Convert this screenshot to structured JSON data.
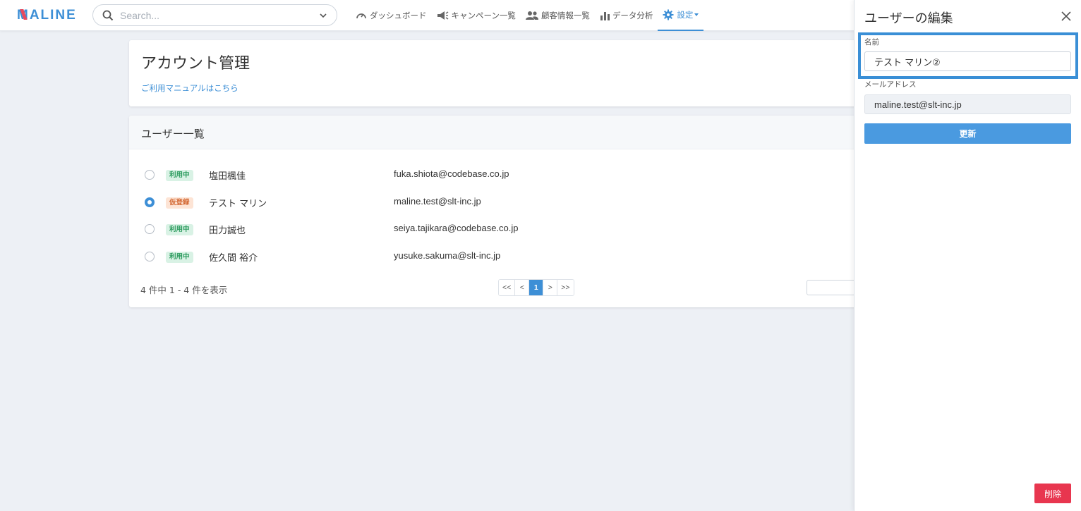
{
  "brand": {
    "logo_text": "MALINE",
    "accent": "#3d8fd6",
    "logo_accent": "#e84a5f"
  },
  "search": {
    "placeholder": "Search...",
    "value": ""
  },
  "nav": [
    {
      "label": "ダッシュボード",
      "icon": "speedometer-icon"
    },
    {
      "label": "キャンペーン一覧",
      "icon": "megaphone-icon"
    },
    {
      "label": "顧客情報一覧",
      "icon": "users-icon"
    },
    {
      "label": "データ分析",
      "icon": "bar-chart-icon"
    },
    {
      "label": "設定",
      "icon": "gear-icon",
      "active": true
    }
  ],
  "account_card": {
    "title": "アカウント管理",
    "manual_link": "ご利用マニュアルはこちら"
  },
  "user_list": {
    "title": "ユーザー一覧",
    "users": [
      {
        "status": "利用中",
        "status_type": "active",
        "name": "塩田楓佳",
        "email": "fuka.shiota@codebase.co.jp",
        "selected": false
      },
      {
        "status": "仮登録",
        "status_type": "temp",
        "name": "テスト マリン",
        "email": "maline.test@slt-inc.jp",
        "selected": true
      },
      {
        "status": "利用中",
        "status_type": "active",
        "name": "田力誠也",
        "email": "seiya.tajikara@codebase.co.jp",
        "selected": false
      },
      {
        "status": "利用中",
        "status_type": "active",
        "name": "佐久間 裕介",
        "email": "yusuke.sakuma@slt-inc.jp",
        "selected": false
      }
    ],
    "count_text": "4 件中 1 - 4 件を表示",
    "pagination": {
      "first": "<<",
      "prev": "<",
      "current": "1",
      "next": ">",
      "last": ">>"
    }
  },
  "edit_panel": {
    "title": "ユーザーの編集",
    "name_label": "名前",
    "name_value": "テスト マリン②",
    "email_label": "メールアドレス",
    "email_value": "maline.test@slt-inc.jp",
    "update_button": "更新",
    "delete_button": "削除"
  }
}
